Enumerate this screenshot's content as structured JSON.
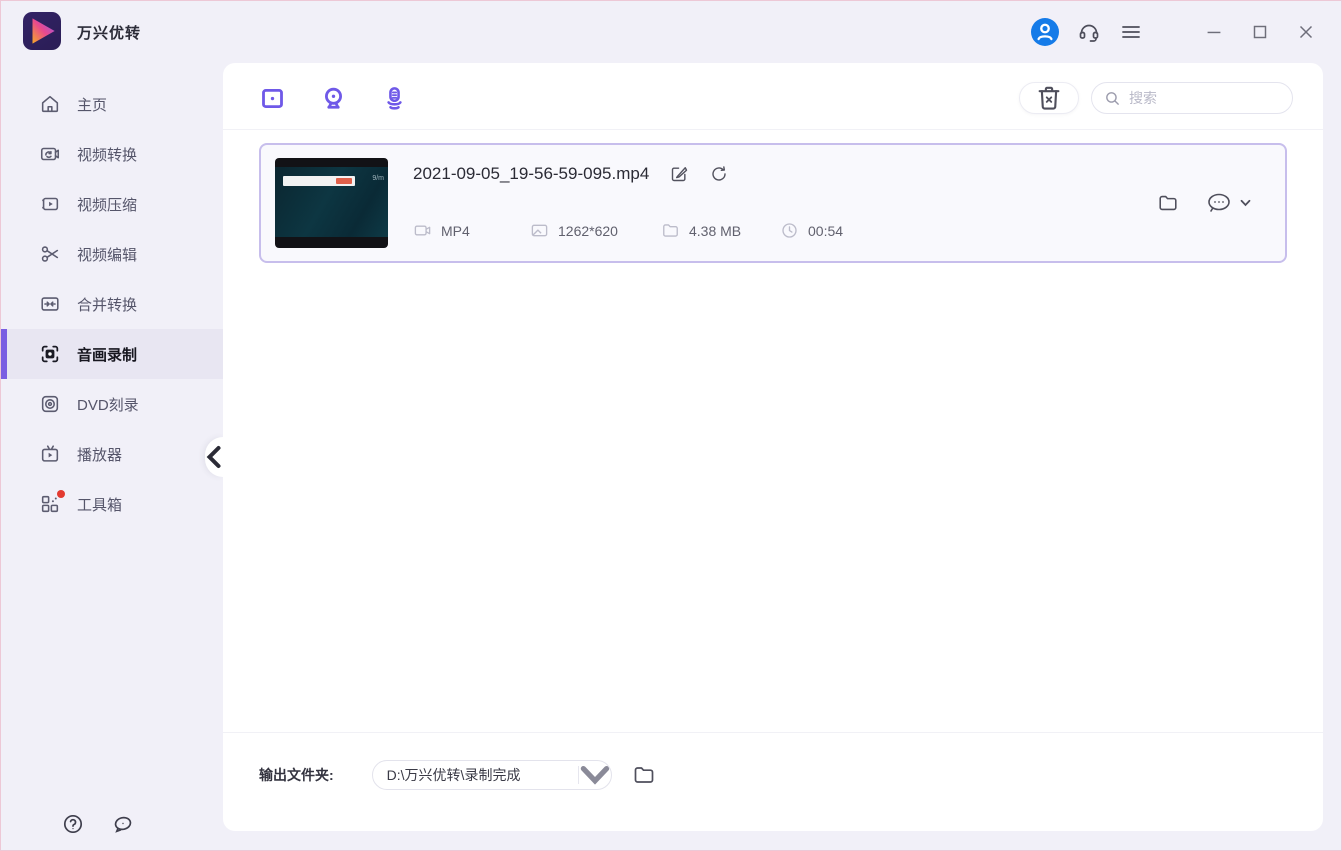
{
  "app": {
    "title": "万兴优转"
  },
  "titlebar": {
    "icons": [
      "user-avatar-icon",
      "headset-support-icon",
      "hamburger-menu-icon"
    ],
    "window_controls": [
      "minimize",
      "maximize",
      "close"
    ]
  },
  "sidebar": {
    "items": [
      {
        "label": "主页",
        "icon": "home-icon",
        "selected": false
      },
      {
        "label": "视频转换",
        "icon": "video-convert-icon",
        "selected": false
      },
      {
        "label": "视频压缩",
        "icon": "video-compress-icon",
        "selected": false
      },
      {
        "label": "视频编辑",
        "icon": "video-edit-icon",
        "selected": false
      },
      {
        "label": "合并转换",
        "icon": "merge-convert-icon",
        "selected": false
      },
      {
        "label": "音画录制",
        "icon": "screen-record-icon",
        "selected": true
      },
      {
        "label": "DVD刻录",
        "icon": "dvd-burn-icon",
        "selected": false
      },
      {
        "label": "播放器",
        "icon": "player-icon",
        "selected": false
      },
      {
        "label": "工具箱",
        "icon": "toolbox-icon",
        "selected": false,
        "badge": true
      }
    ]
  },
  "toolbar": {
    "record_modes": [
      "screen-record-icon",
      "webcam-record-icon",
      "audio-record-icon"
    ],
    "search_placeholder": "搜索"
  },
  "file": {
    "name": "2021-09-05_19-56-59-095.mp4",
    "format": "MP4",
    "resolution": "1262*620",
    "size": "4.38 MB",
    "duration": "00:54"
  },
  "footer": {
    "output_label": "输出文件夹:",
    "output_path": "D:\\万兴优转\\录制完成"
  },
  "colors": {
    "accent_purple": "#6f59e8",
    "selected_bar": "#7a5ee2",
    "avatar_blue": "#157be8",
    "badge_red": "#e33a30",
    "card_border": "#c7beec",
    "background": "#f1f0f8"
  }
}
